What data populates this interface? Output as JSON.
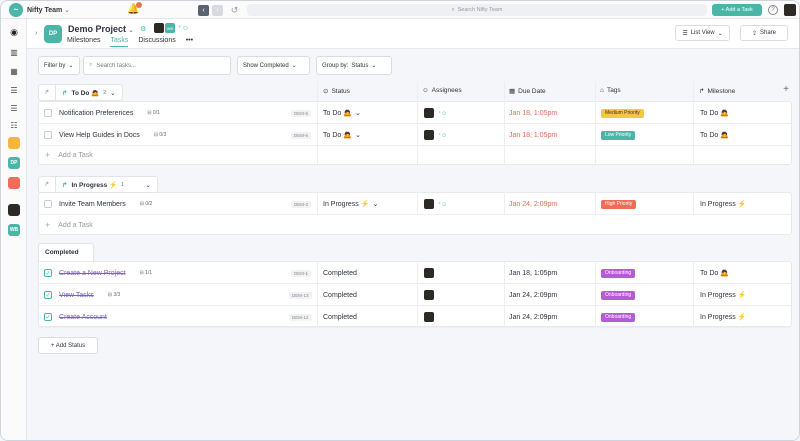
{
  "topbar": {
    "team_name": "Nifty Team",
    "search_placeholder": "Search Nifty Team",
    "add_task_label": "+ Add a Task",
    "help_label": "?"
  },
  "rail": {
    "project_badges": [
      "",
      "DP",
      ""
    ],
    "member_badge": "WB"
  },
  "project": {
    "badge": "DP",
    "name": "Demo Project",
    "member_badge": "WB",
    "tabs": [
      "Milestones",
      "Tasks",
      "Discussions",
      "•••"
    ],
    "active_tab": "Tasks",
    "view_label": "List View",
    "share_label": "Share"
  },
  "filters": {
    "filter_by": "Filter by",
    "search_placeholder": "Search tasks...",
    "show_completed": "Show Completed",
    "group_by": "Group by:",
    "group_by_value": "Status"
  },
  "columns": {
    "status": "Status",
    "assignees": "Assignees",
    "due_date": "Due Date",
    "tags": "Tags",
    "milestone": "Milestone"
  },
  "colors": {
    "accent": "#4ab6a8",
    "medium_priority": "#f5c842",
    "low_priority": "#4ab6a8",
    "high_priority": "#ef6c5a",
    "onboarding": "#b55bd6",
    "overdue": "#e06b58"
  },
  "groups": {
    "todo": {
      "name": "To Do 🙇",
      "count": "2",
      "tasks": [
        {
          "name": "Notification Preferences",
          "subtasks": "0/1",
          "id": "DEM-5",
          "status": "To Do 🙇",
          "due": "Jan 18, 1:05pm",
          "tag": "Medium Priority",
          "milestone": "To Do 🙇"
        },
        {
          "name": "View Help Guides in Docs",
          "subtasks": "0/3",
          "id": "DEM-6",
          "status": "To Do 🙇",
          "due": "Jan 18, 1:05pm",
          "tag": "Low Priority",
          "milestone": "To Do 🙇"
        }
      ],
      "add_label": "Add a Task"
    },
    "inprogress": {
      "name": "In Progress ⚡",
      "count": "1",
      "tasks": [
        {
          "name": "Invite Team Members",
          "subtasks": "0/2",
          "id": "DEM-3",
          "status": "In Progress ⚡",
          "due": "Jan 24, 2:09pm",
          "tag": "High Priority",
          "milestone": "In Progress ⚡"
        }
      ],
      "add_label": "Add a Task"
    },
    "completed": {
      "name": "Completed",
      "tasks": [
        {
          "name": "Create a New Project",
          "subtasks": "1/1",
          "id": "DEM-1",
          "status": "Completed",
          "due": "Jan 18, 1:05pm",
          "tag": "Onboarding",
          "milestone": "To Do 🙇"
        },
        {
          "name": "View Tasks",
          "subtasks": "3/3",
          "id": "DEM-13",
          "status": "Completed",
          "due": "Jan 24, 2:09pm",
          "tag": "Onboarding",
          "milestone": "In Progress ⚡"
        },
        {
          "name": "Create Account",
          "subtasks": "",
          "id": "DEM-12",
          "status": "Completed",
          "due": "Jan 24, 2:09pm",
          "tag": "Onboarding",
          "milestone": "In Progress ⚡"
        }
      ]
    }
  },
  "add_status_label": "+ Add Status"
}
